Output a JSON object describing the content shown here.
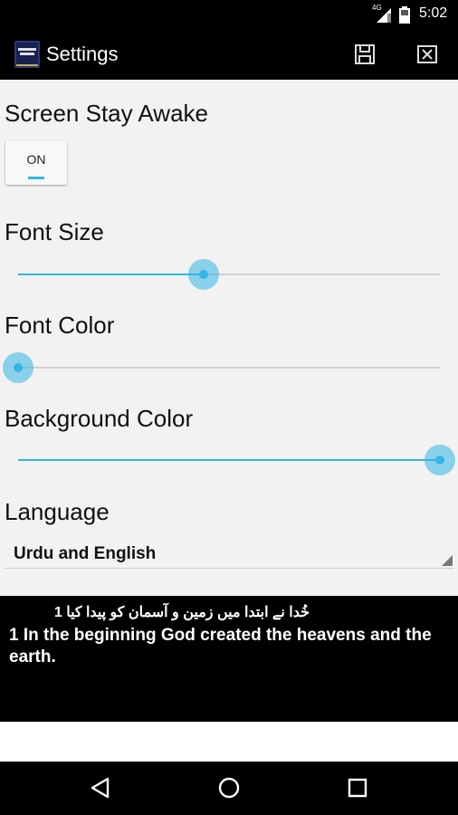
{
  "status_bar": {
    "network": "4G",
    "time": "5:02"
  },
  "action_bar": {
    "title": "Settings",
    "app_icon_text": "BIBLE WEB"
  },
  "settings": {
    "screen_awake": {
      "label": "Screen Stay Awake",
      "toggle_text": "ON"
    },
    "font_size": {
      "label": "Font Size",
      "value_fraction": 0.44
    },
    "font_color": {
      "label": "Font Color",
      "value_fraction": 0.0
    },
    "background_color": {
      "label": "Background Color",
      "value_fraction": 1.0
    },
    "language": {
      "label": "Language",
      "selected": "Urdu and English"
    }
  },
  "preview": {
    "urdu": "خُدا نے ابتدا میں زمین و آسمان کو پیدا کیا 1",
    "english": "1 In the beginning God created the heavens and the earth."
  },
  "colors": {
    "accent": "#33b5e5",
    "background": "#f2f2f2",
    "bars": "#000000"
  }
}
